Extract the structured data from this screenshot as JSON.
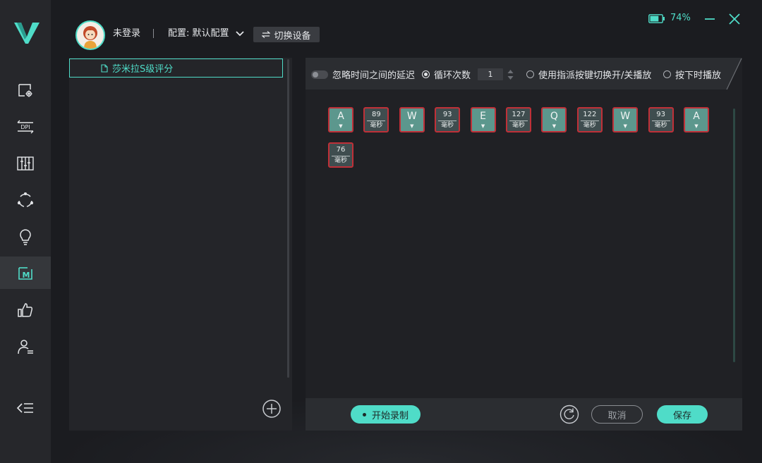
{
  "user": {
    "login_status": "未登录",
    "avatar": "cartoon-girl-avatar"
  },
  "config": {
    "label": "配置: 默认配置"
  },
  "device": {
    "switch_label": "切换设备"
  },
  "battery": {
    "percent_text": "74%",
    "level": 0.74
  },
  "sidebar": {
    "items": [
      {
        "icon": "device-settings-icon"
      },
      {
        "icon": "dpi-icon",
        "text": "DPI"
      },
      {
        "icon": "equalizer-icon"
      },
      {
        "icon": "sync-icon"
      },
      {
        "icon": "lightbulb-icon"
      },
      {
        "icon": "macro-icon",
        "text": "M",
        "active": true
      },
      {
        "icon": "thumbs-up-icon"
      },
      {
        "icon": "user-settings-icon"
      }
    ]
  },
  "macro_list": {
    "items": [
      {
        "name": "莎米拉S级评分",
        "selected": true
      }
    ]
  },
  "options": {
    "ignore_delay_label": "忽略时间之间的延迟",
    "loop_count_label": "循环次数",
    "loop_count_value": "1",
    "toggle_key_label": "使用指派按键切换开/关播放",
    "hold_play_label": "按下时播放"
  },
  "delay_unit": "毫秒",
  "steps": [
    {
      "type": "key",
      "key": "A"
    },
    {
      "type": "delay",
      "ms": "89"
    },
    {
      "type": "key",
      "key": "W"
    },
    {
      "type": "delay",
      "ms": "93"
    },
    {
      "type": "key",
      "key": "E"
    },
    {
      "type": "delay",
      "ms": "127"
    },
    {
      "type": "key",
      "key": "Q"
    },
    {
      "type": "delay",
      "ms": "122"
    },
    {
      "type": "key",
      "key": "W"
    },
    {
      "type": "delay",
      "ms": "93"
    },
    {
      "type": "key",
      "key": "A"
    },
    {
      "type": "delay",
      "ms": "76"
    }
  ],
  "buttons": {
    "record": "开始录制",
    "cancel": "取消",
    "save": "保存"
  },
  "colors": {
    "accent": "#4fdcc8",
    "step_border": "#c03038",
    "key_fill": "#5c978d"
  }
}
